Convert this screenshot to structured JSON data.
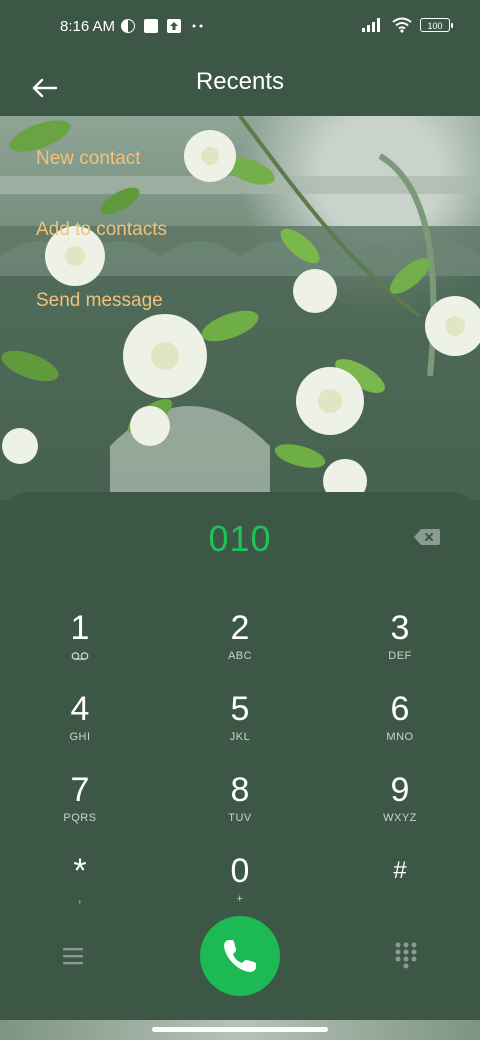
{
  "status_bar": {
    "time": "8:16 AM",
    "battery": "100",
    "icons": [
      "vpn-icon",
      "notification-square-icon",
      "upload-icon",
      "more-dots-icon",
      "signal-icon",
      "wifi-icon",
      "battery-icon"
    ]
  },
  "header": {
    "title": "Recents",
    "back_icon": "arrow-left-icon"
  },
  "actions": {
    "new_contact": "New contact",
    "add_to_contacts": "Add to contacts",
    "send_message": "Send message"
  },
  "dialer": {
    "number": "010",
    "keys": [
      {
        "digit": "1",
        "letters": ""
      },
      {
        "digit": "2",
        "letters": "ABC"
      },
      {
        "digit": "3",
        "letters": "DEF"
      },
      {
        "digit": "4",
        "letters": "GHI"
      },
      {
        "digit": "5",
        "letters": "JKL"
      },
      {
        "digit": "6",
        "letters": "MNO"
      },
      {
        "digit": "7",
        "letters": "PQRS"
      },
      {
        "digit": "8",
        "letters": "TUV"
      },
      {
        "digit": "9",
        "letters": "WXYZ"
      },
      {
        "digit": "*",
        "letters": ","
      },
      {
        "digit": "0",
        "letters": "+"
      },
      {
        "digit": "#",
        "letters": ""
      }
    ]
  },
  "colors": {
    "background": "#3d5747",
    "accent_green": "#20c05a",
    "call_button": "#1db954",
    "action_text": "#f2c27a"
  }
}
